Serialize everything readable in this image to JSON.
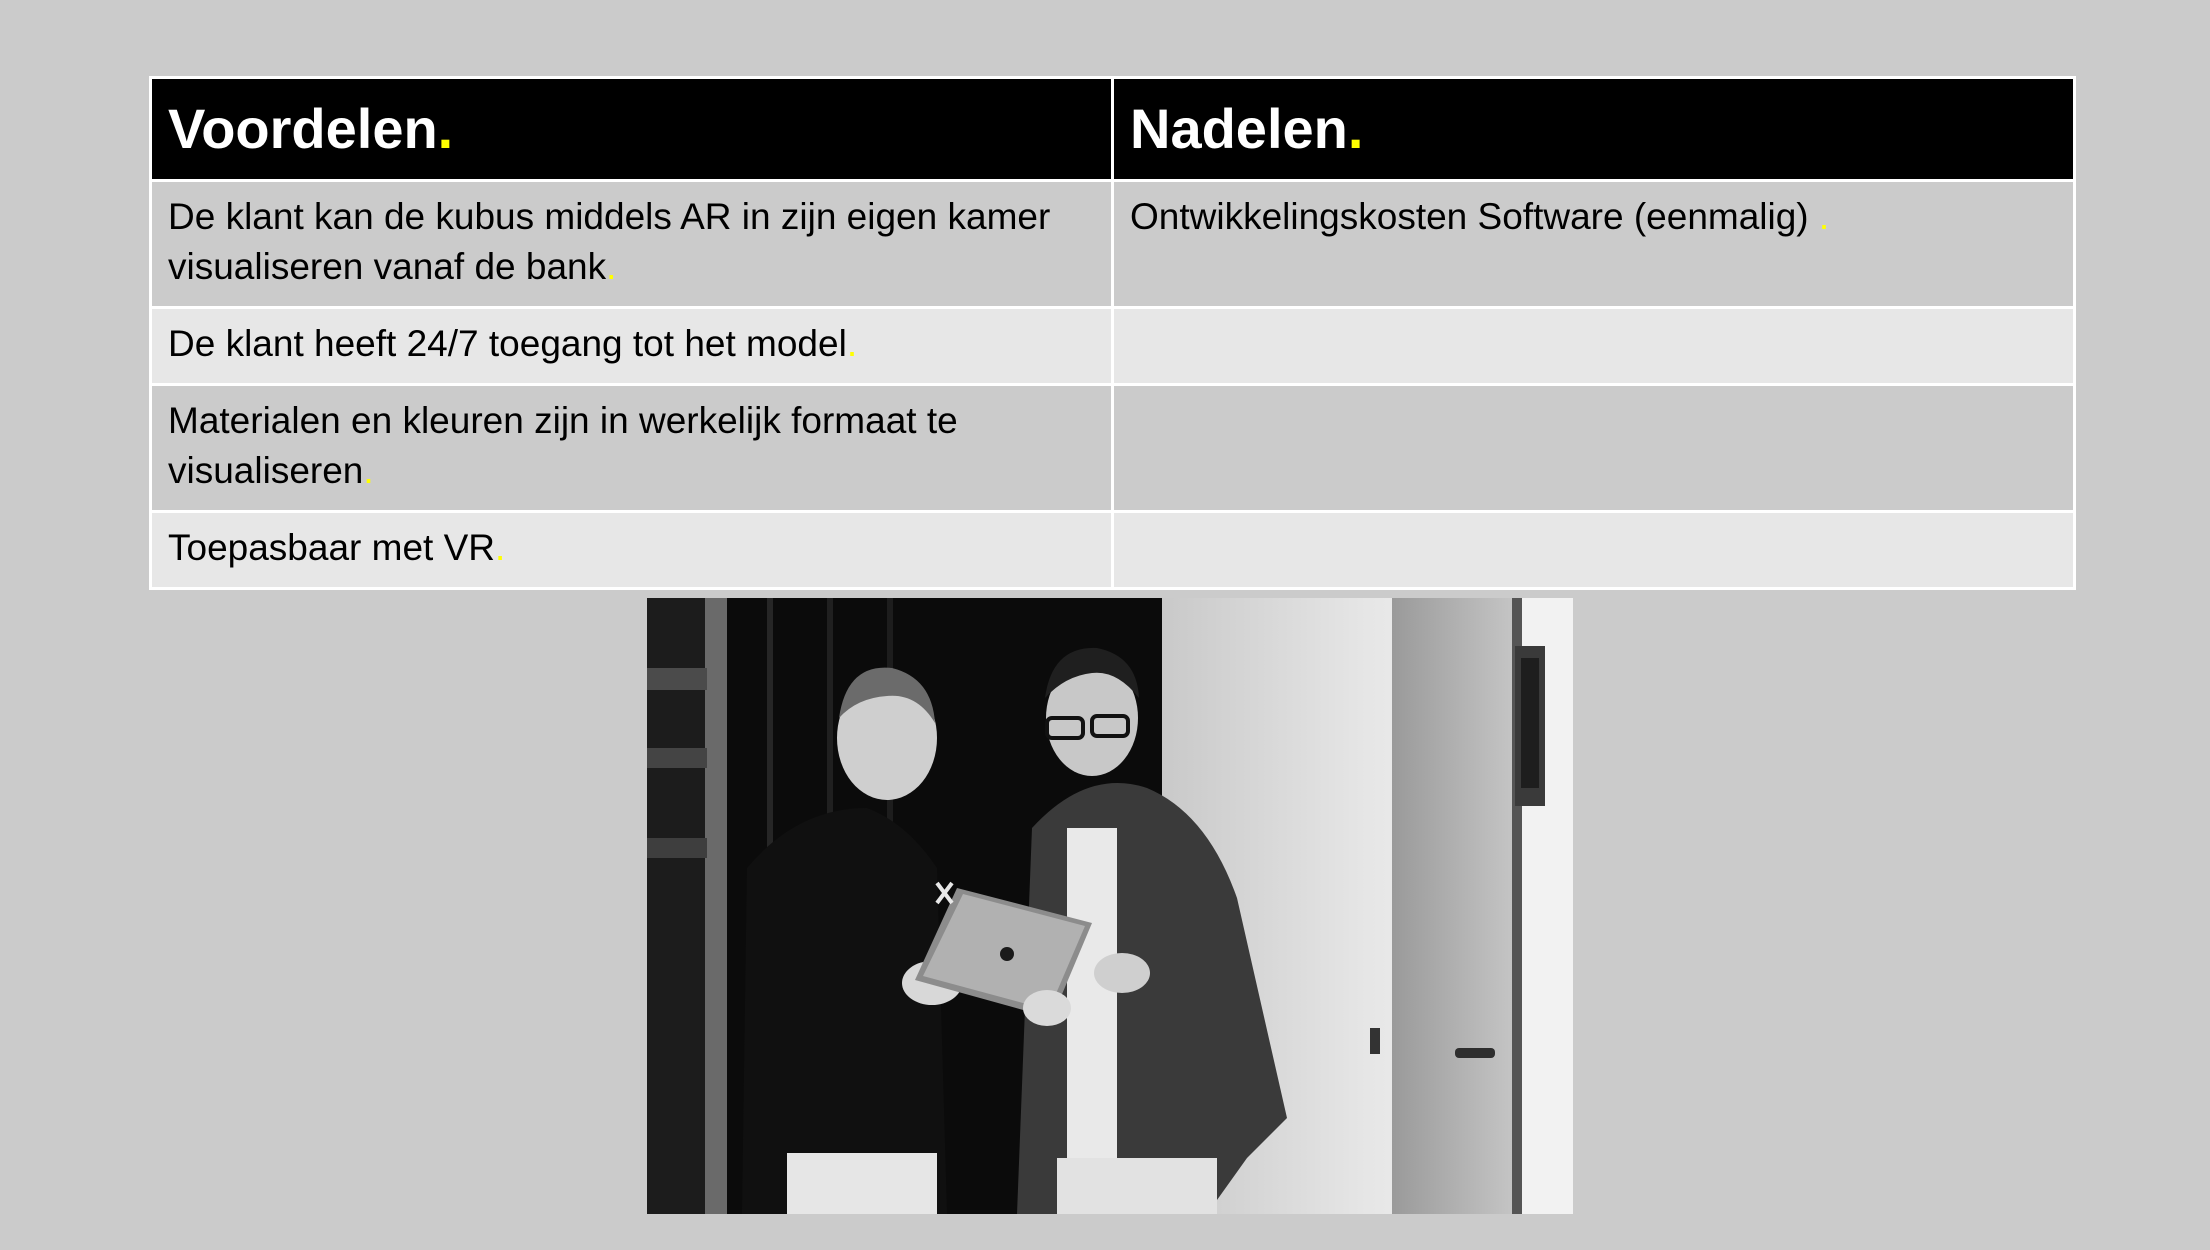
{
  "table": {
    "headers": [
      {
        "label": "Voordelen",
        "dot": "."
      },
      {
        "label": "Nadelen",
        "dot": "."
      }
    ],
    "rows": [
      {
        "left": "De klant kan de kubus middels AR in zijn eigen kamer visualiseren vanaf de bank",
        "left_dot": ".",
        "right": "Ontwikkelingskosten Software (eenmalig) ",
        "right_dot": "."
      },
      {
        "left": "De klant heeft 24/7 toegang tot het model",
        "left_dot": ".",
        "right": "",
        "right_dot": ""
      },
      {
        "left": "Materialen en kleuren zijn in werkelijk formaat te visualiseren",
        "left_dot": ".",
        "right": "",
        "right_dot": ""
      },
      {
        "left": "Toepasbaar met VR",
        "left_dot": ".",
        "right": "",
        "right_dot": ""
      }
    ]
  },
  "colors": {
    "background": "#cbcbcb",
    "header_bg": "#000000",
    "accent_dot": "#ffff00",
    "row_band_light": "#e7e7e7"
  }
}
